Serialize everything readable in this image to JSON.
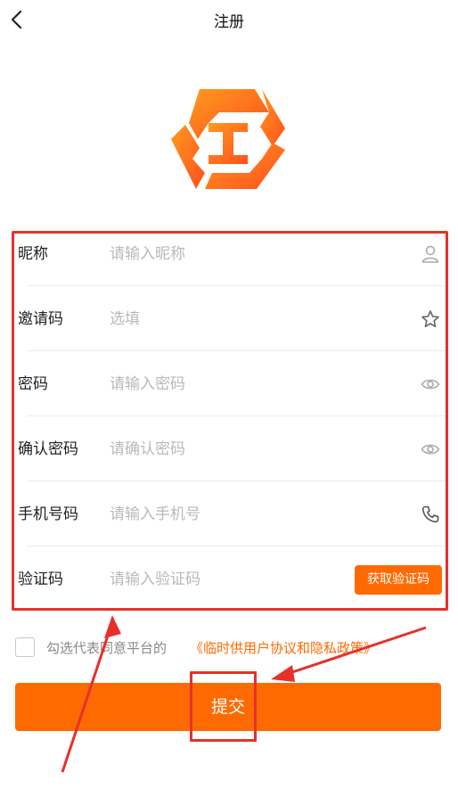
{
  "header": {
    "title": "注册",
    "back_icon": "chevron-left-icon"
  },
  "logo": {
    "name": "app-logo",
    "colors": [
      "#ff8a1a",
      "#ff5a1e"
    ]
  },
  "form": {
    "rows": [
      {
        "label": "昵称",
        "placeholder": "请输入昵称",
        "icon": "user-icon"
      },
      {
        "label": "邀请码",
        "placeholder": "选填",
        "icon": "star-icon"
      },
      {
        "label": "密码",
        "placeholder": "请输入密码",
        "icon": "eye-icon"
      },
      {
        "label": "确认密码",
        "placeholder": "请确认密码",
        "icon": "eye-icon"
      },
      {
        "label": "手机号码",
        "placeholder": "请输入手机号",
        "icon": "phone-icon"
      },
      {
        "label": "验证码",
        "placeholder": "请输入验证码"
      }
    ],
    "get_code_button": "获取验证码"
  },
  "agreement": {
    "text": "勾选代表同意平台的",
    "link": "《临时供用户协议和隐私政策》",
    "checked": false
  },
  "submit": {
    "label": "提交"
  },
  "colors": {
    "accent": "#ff6a00",
    "annotation": "#e8302b"
  }
}
